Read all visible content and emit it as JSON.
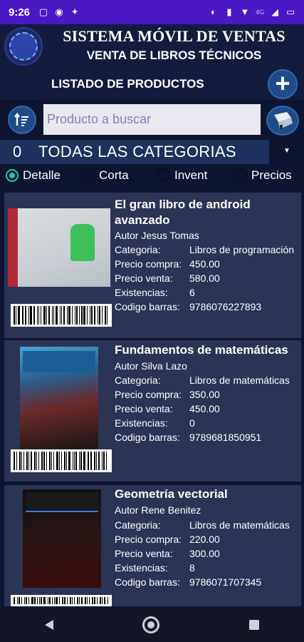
{
  "status_bar": {
    "time": "9:26",
    "network_label": "4G",
    "icons": [
      "media-icon",
      "at-icon",
      "wrench-icon",
      "cast-icon",
      "vibrate-icon",
      "wifi-icon",
      "signal-icon",
      "battery-icon"
    ]
  },
  "header": {
    "title": "SISTEMA MÓVIL DE VENTAS",
    "subtitle": "VENTA DE LIBROS TÉCNICOS"
  },
  "list_bar": {
    "title": "LISTADO DE PRODUCTOS",
    "add_icon": "plus-icon"
  },
  "search": {
    "placeholder": "Producto a buscar",
    "value": ""
  },
  "category": {
    "count": "0",
    "label": "TODAS LAS CATEGORIAS"
  },
  "view_modes": {
    "selected": "Detalle",
    "options": [
      "Detalle",
      "Corta",
      "Invent",
      "Precios"
    ]
  },
  "field_labels": {
    "categoria": "Categoria:",
    "precio_compra": "Precio compra:",
    "precio_venta": "Precio venta:",
    "existencias": "Existencias:",
    "codigo_barras": "Codigo barras:"
  },
  "products": [
    {
      "name": "El gran libro de android avanzado",
      "author": "Autor Jesus Tomas",
      "categoria": "Libros de programación",
      "precio_compra": "450.00",
      "precio_venta": "580.00",
      "existencias": "6",
      "codigo_barras": "9786076227893"
    },
    {
      "name": "Fundamentos de matemáticas",
      "author": "Autor Silva Lazo",
      "categoria": "Libros de matemáticas",
      "precio_compra": "350.00",
      "precio_venta": "450.00",
      "existencias": "0",
      "codigo_barras": "9789681850951"
    },
    {
      "name": "Geometría vectorial",
      "author": "Autor Rene Benitez",
      "categoria": "Libros de matemáticas",
      "precio_compra": "220.00",
      "precio_venta": "300.00",
      "existencias": "8",
      "codigo_barras": "9786071707345"
    }
  ],
  "colors": {
    "status_bar": "#4a17c4",
    "background": "#0e1530",
    "card": "#2b3454",
    "accent": "#21c3a8",
    "button": "#1f4c89"
  }
}
